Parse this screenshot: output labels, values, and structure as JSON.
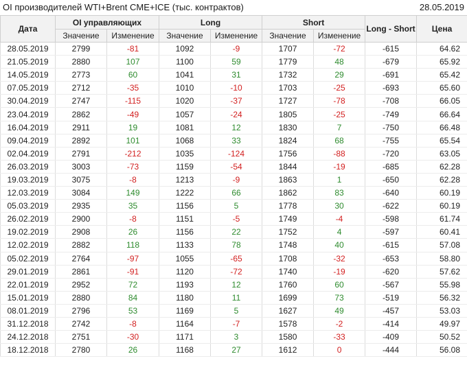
{
  "header": {
    "title": "OI производителей WTI+Brent CME+ICE (тыс. контрактов)",
    "date": "28.05.2019"
  },
  "columns": {
    "date": "Дата",
    "oi_managing": "OI управляющих",
    "long": "Long",
    "short": "Short",
    "long_short": "Long - Short",
    "price": "Цена",
    "value": "Значение",
    "change": "Изменение"
  },
  "colors": {
    "positive": "#2e8b2e",
    "negative": "#d21f1f",
    "header_bg": "#f2f2f2"
  },
  "rows": [
    {
      "date": "28.05.2019",
      "oi": "2799",
      "oi_ch": "-81",
      "long": "1092",
      "long_ch": "-9",
      "short": "1707",
      "short_ch": "-72",
      "ls": "-615",
      "price": "64.62"
    },
    {
      "date": "21.05.2019",
      "oi": "2880",
      "oi_ch": "107",
      "long": "1100",
      "long_ch": "59",
      "short": "1779",
      "short_ch": "48",
      "ls": "-679",
      "price": "65.92"
    },
    {
      "date": "14.05.2019",
      "oi": "2773",
      "oi_ch": "60",
      "long": "1041",
      "long_ch": "31",
      "short": "1732",
      "short_ch": "29",
      "ls": "-691",
      "price": "65.42"
    },
    {
      "date": "07.05.2019",
      "oi": "2712",
      "oi_ch": "-35",
      "long": "1010",
      "long_ch": "-10",
      "short": "1703",
      "short_ch": "-25",
      "ls": "-693",
      "price": "65.60"
    },
    {
      "date": "30.04.2019",
      "oi": "2747",
      "oi_ch": "-115",
      "long": "1020",
      "long_ch": "-37",
      "short": "1727",
      "short_ch": "-78",
      "ls": "-708",
      "price": "66.05"
    },
    {
      "date": "23.04.2019",
      "oi": "2862",
      "oi_ch": "-49",
      "long": "1057",
      "long_ch": "-24",
      "short": "1805",
      "short_ch": "-25",
      "ls": "-749",
      "price": "66.64"
    },
    {
      "date": "16.04.2019",
      "oi": "2911",
      "oi_ch": "19",
      "long": "1081",
      "long_ch": "12",
      "short": "1830",
      "short_ch": "7",
      "ls": "-750",
      "price": "66.48"
    },
    {
      "date": "09.04.2019",
      "oi": "2892",
      "oi_ch": "101",
      "long": "1068",
      "long_ch": "33",
      "short": "1824",
      "short_ch": "68",
      "ls": "-755",
      "price": "65.54"
    },
    {
      "date": "02.04.2019",
      "oi": "2791",
      "oi_ch": "-212",
      "long": "1035",
      "long_ch": "-124",
      "short": "1756",
      "short_ch": "-88",
      "ls": "-720",
      "price": "63.05"
    },
    {
      "date": "26.03.2019",
      "oi": "3003",
      "oi_ch": "-73",
      "long": "1159",
      "long_ch": "-54",
      "short": "1844",
      "short_ch": "-19",
      "ls": "-685",
      "price": "62.28"
    },
    {
      "date": "19.03.2019",
      "oi": "3075",
      "oi_ch": "-8",
      "long": "1213",
      "long_ch": "-9",
      "short": "1863",
      "short_ch": "1",
      "ls": "-650",
      "price": "62.28"
    },
    {
      "date": "12.03.2019",
      "oi": "3084",
      "oi_ch": "149",
      "long": "1222",
      "long_ch": "66",
      "short": "1862",
      "short_ch": "83",
      "ls": "-640",
      "price": "60.19"
    },
    {
      "date": "05.03.2019",
      "oi": "2935",
      "oi_ch": "35",
      "long": "1156",
      "long_ch": "5",
      "short": "1778",
      "short_ch": "30",
      "ls": "-622",
      "price": "60.19"
    },
    {
      "date": "26.02.2019",
      "oi": "2900",
      "oi_ch": "-8",
      "long": "1151",
      "long_ch": "-5",
      "short": "1749",
      "short_ch": "-4",
      "ls": "-598",
      "price": "61.74"
    },
    {
      "date": "19.02.2019",
      "oi": "2908",
      "oi_ch": "26",
      "long": "1156",
      "long_ch": "22",
      "short": "1752",
      "short_ch": "4",
      "ls": "-597",
      "price": "60.41"
    },
    {
      "date": "12.02.2019",
      "oi": "2882",
      "oi_ch": "118",
      "long": "1133",
      "long_ch": "78",
      "short": "1748",
      "short_ch": "40",
      "ls": "-615",
      "price": "57.08"
    },
    {
      "date": "05.02.2019",
      "oi": "2764",
      "oi_ch": "-97",
      "long": "1055",
      "long_ch": "-65",
      "short": "1708",
      "short_ch": "-32",
      "ls": "-653",
      "price": "58.80"
    },
    {
      "date": "29.01.2019",
      "oi": "2861",
      "oi_ch": "-91",
      "long": "1120",
      "long_ch": "-72",
      "short": "1740",
      "short_ch": "-19",
      "ls": "-620",
      "price": "57.62"
    },
    {
      "date": "22.01.2019",
      "oi": "2952",
      "oi_ch": "72",
      "long": "1193",
      "long_ch": "12",
      "short": "1760",
      "short_ch": "60",
      "ls": "-567",
      "price": "55.98"
    },
    {
      "date": "15.01.2019",
      "oi": "2880",
      "oi_ch": "84",
      "long": "1180",
      "long_ch": "11",
      "short": "1699",
      "short_ch": "73",
      "ls": "-519",
      "price": "56.32"
    },
    {
      "date": "08.01.2019",
      "oi": "2796",
      "oi_ch": "53",
      "long": "1169",
      "long_ch": "5",
      "short": "1627",
      "short_ch": "49",
      "ls": "-457",
      "price": "53.03"
    },
    {
      "date": "31.12.2018",
      "oi": "2742",
      "oi_ch": "-8",
      "long": "1164",
      "long_ch": "-7",
      "short": "1578",
      "short_ch": "-2",
      "ls": "-414",
      "price": "49.97"
    },
    {
      "date": "24.12.2018",
      "oi": "2751",
      "oi_ch": "-30",
      "long": "1171",
      "long_ch": "3",
      "short": "1580",
      "short_ch": "-33",
      "ls": "-409",
      "price": "50.52"
    },
    {
      "date": "18.12.2018",
      "oi": "2780",
      "oi_ch": "26",
      "long": "1168",
      "long_ch": "27",
      "short": "1612",
      "short_ch": "0",
      "ls": "-444",
      "price": "56.08"
    }
  ]
}
